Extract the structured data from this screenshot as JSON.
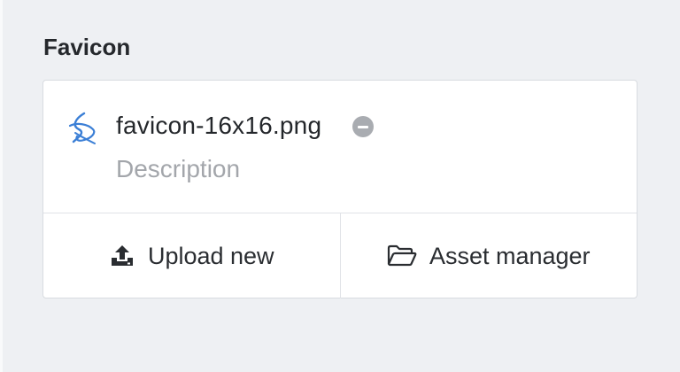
{
  "section": {
    "label": "Favicon"
  },
  "file": {
    "name": "favicon-16x16.png",
    "icon": "favicon-file-icon",
    "description_placeholder": "Description",
    "description_value": ""
  },
  "actions": {
    "upload_label": "Upload new",
    "upload_icon": "upload-icon",
    "asset_manager_label": "Asset manager",
    "asset_manager_icon": "folder-open-icon"
  },
  "colors": {
    "accent": "#3b7fd6",
    "text": "#24272b",
    "muted": "#a3a6ab",
    "background": "#eef0f3"
  }
}
